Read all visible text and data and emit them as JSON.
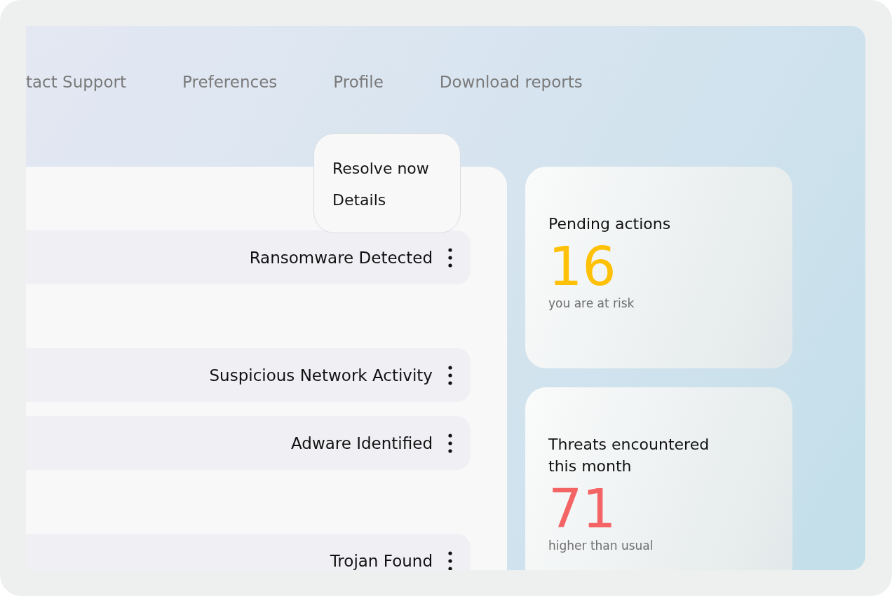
{
  "nav": [
    "tact Support",
    "Preferences",
    "Profile",
    "Download reports"
  ],
  "threats": [
    {
      "name": "Ransomware Detected"
    },
    {
      "name": "Suspicious Network Activity"
    },
    {
      "name": "Adware Identified"
    },
    {
      "name": "Trojan Found"
    }
  ],
  "menu": [
    "Resolve now",
    "Details"
  ],
  "cards": [
    {
      "title": "Pending actions",
      "value": "16",
      "caption": "you are at risk",
      "color": "#ffc107"
    },
    {
      "title": "Threats encountered this month",
      "value": "71",
      "caption": "higher than usual",
      "color": "#f46464"
    }
  ]
}
